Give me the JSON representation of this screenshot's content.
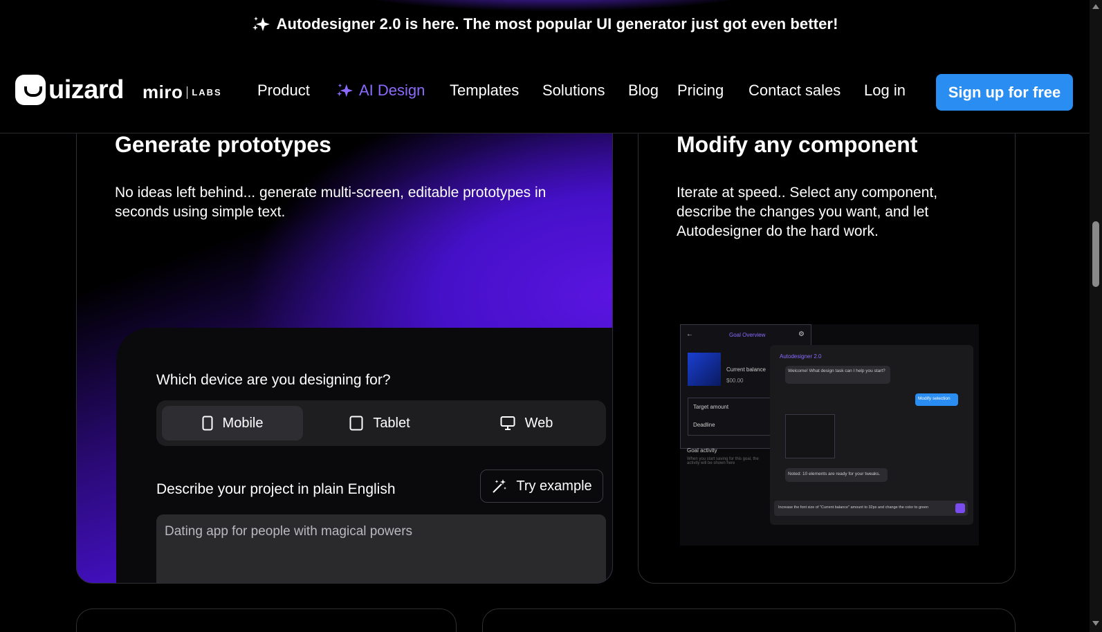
{
  "announcement": {
    "text": "Autodesigner 2.0 is here. The most popular UI generator just got even better!",
    "icon": "sparkle-icon"
  },
  "nav": {
    "logo": "uizard",
    "partner": "miro",
    "partner_tag": "LABS",
    "links": [
      "Product",
      "AI Design",
      "Templates",
      "Solutions",
      "Blog",
      "Pricing",
      "Contact sales",
      "Log in"
    ],
    "signup": "Sign up for free",
    "accent": "#8b6bff",
    "cta_color": "#2a8df2"
  },
  "cards": {
    "left": {
      "title": "Generate prototypes",
      "desc": "No ideas left behind... generate multi-screen, editable prototypes in seconds using simple text.",
      "question": "Which device are you designing for?",
      "devices": [
        "Mobile",
        "Tablet",
        "Web"
      ],
      "selected_device": "Mobile",
      "describe_label": "Describe your project in plain English",
      "try_label": "Try example",
      "textarea_value": "Dating app for people with magical powers"
    },
    "right": {
      "title": "Modify any component",
      "desc": "Iterate at speed.. Select any component, describe the changes you want, and let Autodesigner do the hard work.",
      "mock": {
        "goal_title": "Goal Overview",
        "current_balance": "Current balance",
        "balance_value": "$00.00",
        "target_amount": "Target amount",
        "deadline": "Deadline",
        "goal_activity": "Goal activity",
        "activity_note": "When you start saving for this goal, the activity will be shown here",
        "chat_title": "Autodesigner 2.0",
        "bot_msg1": "Welcome! What design task can I help you start?",
        "user_msg": "Modify selection",
        "bot_msg2": "Noted: 10 elements are ready for your tweaks.",
        "input_text": "Increase the font size of \"Current balance\" amount to 32px and change the color to green"
      }
    }
  }
}
